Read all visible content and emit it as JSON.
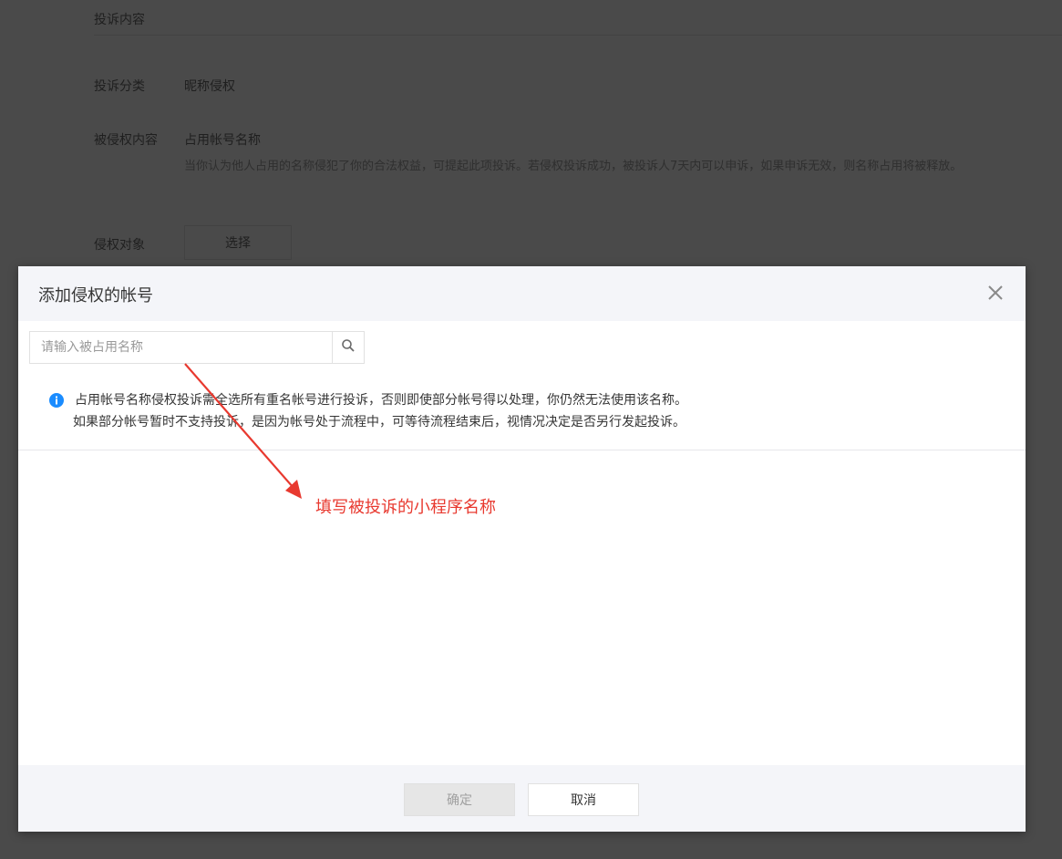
{
  "background_page": {
    "section_title": "投诉内容",
    "fields": [
      {
        "label": "投诉分类",
        "value": "昵称侵权"
      },
      {
        "label": "被侵权内容",
        "value": "占用帐号名称"
      },
      {
        "label": "侵权对象",
        "value": ""
      }
    ],
    "description": "当你认为他人占用的名称侵犯了你的合法权益，可提起此项投诉。若侵权投诉成功，被投诉人7天内可以申诉，如果申诉无效，则名称占用将被释放。",
    "select_button": "选择"
  },
  "modal": {
    "title": "添加侵权的帐号",
    "search": {
      "placeholder": "请输入被占用名称",
      "value": ""
    },
    "notice_lines": [
      "占用帐号名称侵权投诉需全选所有重名帐号进行投诉，否则即使部分帐号得以处理，你仍然无法使用该名称。",
      "如果部分帐号暂时不支持投诉，是因为帐号处于流程中，可等待流程结束后，视情况决定是否另行发起投诉。"
    ],
    "confirm_button": "确定",
    "cancel_button": "取消"
  },
  "annotation": {
    "text": "填写被投诉的小程序名称",
    "color": "#e8392f"
  },
  "colors": {
    "overlay": "#4a4a4a",
    "info_icon": "#1a8cff",
    "header_bg": "#f4f5f9"
  },
  "icons": {
    "close": "close-icon",
    "search": "search-icon",
    "info": "info-icon"
  }
}
